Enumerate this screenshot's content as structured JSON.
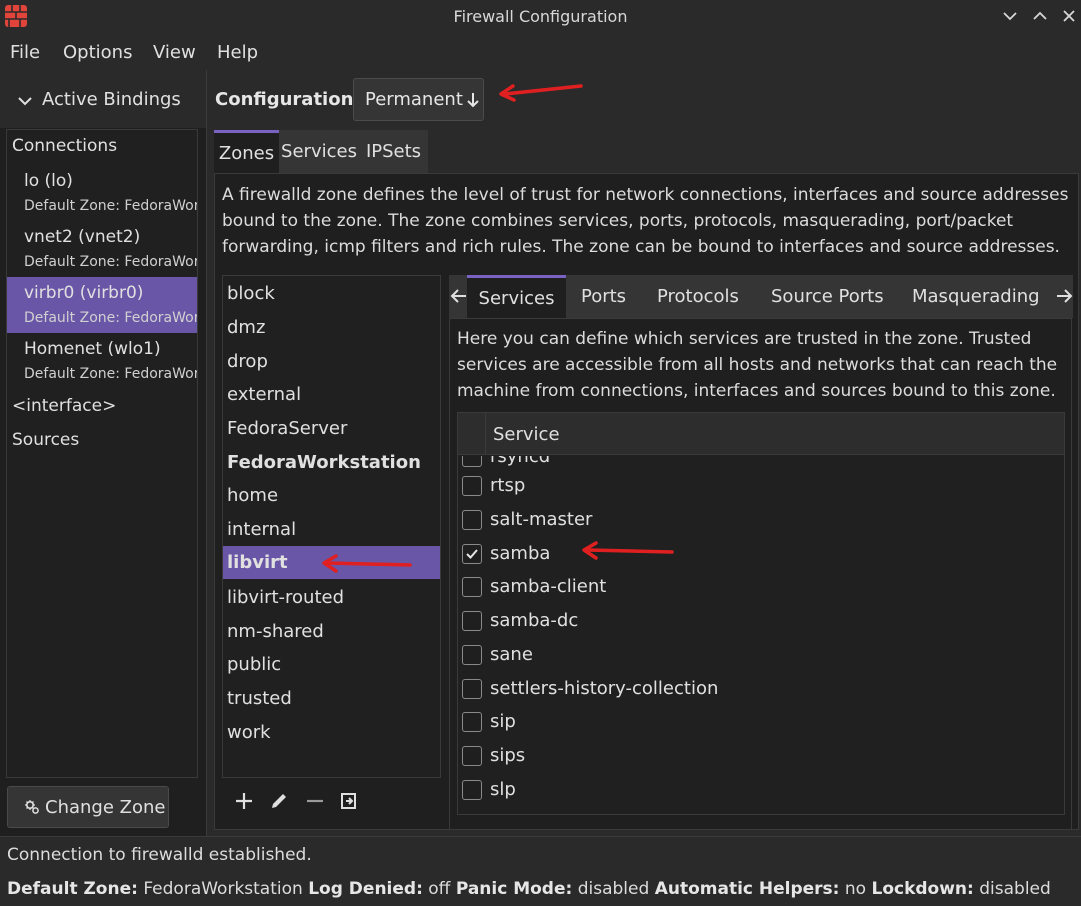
{
  "window": {
    "title": "Firewall Configuration"
  },
  "menu": [
    "File",
    "Options",
    "View",
    "Help"
  ],
  "sidebar": {
    "active_bindings_label": "Active Bindings",
    "items": [
      {
        "label": "Connections"
      },
      {
        "label": "lo (lo)",
        "sub": "Default Zone: FedoraWorkstation"
      },
      {
        "label": "vnet2 (vnet2)",
        "sub": "Default Zone: FedoraWorkstation"
      },
      {
        "label": "virbr0 (virbr0)",
        "sub": "Default Zone: FedoraWorkstation",
        "selected": true
      },
      {
        "label": "Homenet (wlo1)",
        "sub": "Default Zone: FedoraWorkstation"
      },
      {
        "label": "<interface>"
      },
      {
        "label": "Sources"
      }
    ],
    "change_zone_label": "Change Zone"
  },
  "configuration": {
    "label": "Configuration:",
    "value": "Permanent"
  },
  "top_tabs": [
    "Zones",
    "Services",
    "IPSets"
  ],
  "zones": {
    "description": "A firewalld zone defines the level of trust for network connections, interfaces and source addresses bound to the zone. The zone combines services, ports, protocols, masquerading, port/packet forwarding, icmp filters and rich rules. The zone can be bound to interfaces and source addresses.",
    "list": [
      "block",
      "dmz",
      "drop",
      "external",
      "FedoraServer",
      "FedoraWorkstation",
      "home",
      "internal",
      "libvirt",
      "libvirt-routed",
      "nm-shared",
      "public",
      "trusted",
      "work"
    ],
    "default_zone": "FedoraWorkstation",
    "selected": "libvirt"
  },
  "inner_tabs": [
    "Services",
    "Ports",
    "Protocols",
    "Source Ports",
    "Masquerading"
  ],
  "services": {
    "description": "Here you can define which services are trusted in the zone. Trusted services are accessible from all hosts and networks that can reach the machine from connections, interfaces and sources bound to this zone.",
    "column_header": "Service",
    "rows": [
      {
        "name": "rsyncd",
        "checked": false
      },
      {
        "name": "rtsp",
        "checked": false
      },
      {
        "name": "salt-master",
        "checked": false
      },
      {
        "name": "samba",
        "checked": true
      },
      {
        "name": "samba-client",
        "checked": false
      },
      {
        "name": "samba-dc",
        "checked": false
      },
      {
        "name": "sane",
        "checked": false
      },
      {
        "name": "settlers-history-collection",
        "checked": false
      },
      {
        "name": "sip",
        "checked": false
      },
      {
        "name": "sips",
        "checked": false
      },
      {
        "name": "slp",
        "checked": false
      }
    ]
  },
  "status": {
    "message": "Connection to firewalld established.",
    "default_zone_label": "Default Zone:",
    "default_zone_value": "FedoraWorkstation",
    "log_denied_label": "Log Denied:",
    "log_denied_value": "off",
    "panic_mode_label": "Panic Mode:",
    "panic_mode_value": "disabled",
    "automatic_helpers_label": "Automatic Helpers:",
    "automatic_helpers_value": "no",
    "lockdown_label": "Lockdown:",
    "lockdown_value": "disabled"
  },
  "colors": {
    "accent": "#6a56a7",
    "annotation_arrow": "#e02020",
    "app_icon": "#e0443a"
  },
  "icons": {
    "app": "firewall-brick-icon",
    "window_controls": [
      "minimize-chevron-icon",
      "maximize-chevron-icon",
      "close-x-icon"
    ],
    "zone_toolbar": [
      "plus-icon",
      "edit-pencil-icon",
      "minus-icon",
      "load-defaults-icon"
    ]
  }
}
